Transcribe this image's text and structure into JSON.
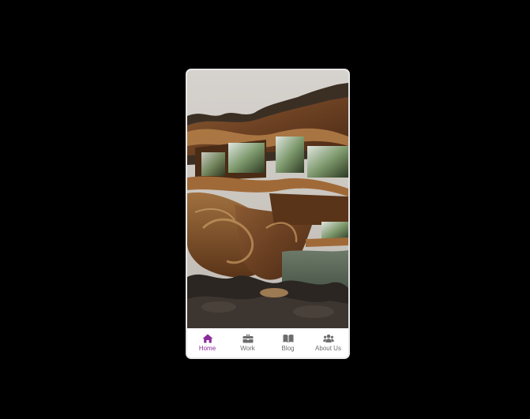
{
  "colors": {
    "page_background": "#000000",
    "active_tab": "#8a2c9a",
    "inactive_tab": "#6d6d6d"
  },
  "hero": {
    "image": "surreal-tree-house-on-rocks"
  },
  "tabbar": {
    "active_index": 0,
    "tabs": [
      {
        "label": "Home",
        "icon": "home-icon"
      },
      {
        "label": "Work",
        "icon": "briefcase-icon"
      },
      {
        "label": "Blog",
        "icon": "book-icon"
      },
      {
        "label": "About Us",
        "icon": "users-icon"
      }
    ]
  }
}
